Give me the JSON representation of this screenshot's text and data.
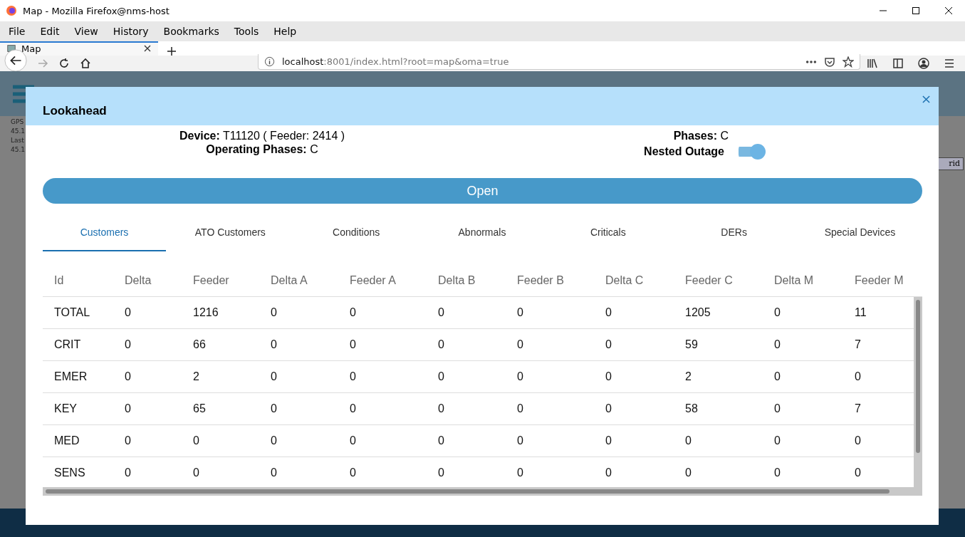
{
  "window": {
    "title": "Map - Mozilla Firefox@nms-host"
  },
  "menu": [
    "File",
    "Edit",
    "View",
    "History",
    "Bookmarks",
    "Tools",
    "Help"
  ],
  "browser_tabs": [
    {
      "label": "Map",
      "selected": true
    }
  ],
  "address": {
    "host": "localhost",
    "rest": ":8001/index.html?root=map&oma=true"
  },
  "background": {
    "side_texts": [
      "GPS",
      "45.1",
      "Last",
      "45.1"
    ],
    "button_text": "rid"
  },
  "dialog": {
    "title": "Lookahead",
    "device_label": "Device:",
    "device_value": "T11120 ( Feeder: 2414 )",
    "operating_label": "Operating Phases:",
    "operating_value": "C",
    "phases_label": "Phases:",
    "phases_value": "C",
    "nested_outage": {
      "label": "Nested Outage",
      "on": true
    },
    "open_button": "Open",
    "tabs": [
      {
        "label": "Customers",
        "selected": true
      },
      {
        "label": "ATO Customers",
        "selected": false
      },
      {
        "label": "Conditions",
        "selected": false
      },
      {
        "label": "Abnormals",
        "selected": false
      },
      {
        "label": "Criticals",
        "selected": false
      },
      {
        "label": "DERs",
        "selected": false
      },
      {
        "label": "Special Devices",
        "selected": false
      }
    ],
    "table": {
      "columns": [
        "Id",
        "Delta",
        "Feeder",
        "Delta A",
        "Feeder A",
        "Delta B",
        "Feeder B",
        "Delta C",
        "Feeder C",
        "Delta M",
        "Feeder M"
      ],
      "rows": [
        [
          "TOTAL",
          "0",
          "1216",
          "0",
          "0",
          "0",
          "0",
          "0",
          "1205",
          "0",
          "11"
        ],
        [
          "CRIT",
          "0",
          "66",
          "0",
          "0",
          "0",
          "0",
          "0",
          "59",
          "0",
          "7"
        ],
        [
          "EMER",
          "0",
          "2",
          "0",
          "0",
          "0",
          "0",
          "0",
          "2",
          "0",
          "0"
        ],
        [
          "KEY",
          "0",
          "65",
          "0",
          "0",
          "0",
          "0",
          "0",
          "58",
          "0",
          "7"
        ],
        [
          "MED",
          "0",
          "0",
          "0",
          "0",
          "0",
          "0",
          "0",
          "0",
          "0",
          "0"
        ],
        [
          "SENS",
          "0",
          "0",
          "0",
          "0",
          "0",
          "0",
          "0",
          "0",
          "0",
          "0"
        ]
      ]
    }
  }
}
